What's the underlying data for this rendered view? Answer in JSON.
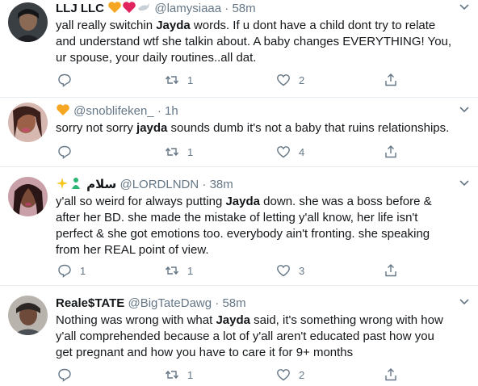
{
  "tweets": [
    {
      "name": "LLJ LLC",
      "handle": "@lamysiaaa",
      "dot": "·",
      "time": "58m",
      "lines": [
        [
          "yall really switchin ",
          "Jayda",
          " words. If u dont have a child dont try to relate"
        ],
        [
          "and understand wtf she talkin about. A baby changes EVERYTHING! You,",
          "",
          ""
        ],
        [
          "ur spouse, your daily routines..all dat.",
          "",
          ""
        ]
      ],
      "reply_count": "",
      "retweet_count": "1",
      "like_count": "2"
    },
    {
      "name": "",
      "handle": "@snoblifeken_",
      "dot": "·",
      "time": "1h",
      "lines": [
        [
          "sorry not sorry ",
          "jayda",
          " sounds dumb it's not a baby that ruins relationships."
        ]
      ],
      "reply_count": "",
      "retweet_count": "1",
      "like_count": "4"
    },
    {
      "name": "سلام",
      "handle": "@LORDLNDN",
      "dot": "·",
      "time": "38m",
      "lines": [
        [
          "y'all so weird for always putting ",
          "Jayda",
          " down. she was a boss before &"
        ],
        [
          "after her BD. she made the mistake of letting y'all know, her life isn't",
          "",
          ""
        ],
        [
          "perfect & she got emotions too. everybody ain't fronting. she speaking",
          "",
          ""
        ],
        [
          "from her REAL point of view.",
          "",
          ""
        ]
      ],
      "reply_count": "1",
      "retweet_count": "1",
      "like_count": "3"
    },
    {
      "name": "Reale$TATE",
      "handle": "@BigTateDawg",
      "dot": "·",
      "time": "58m",
      "lines": [
        [
          "Nothing was wrong with what ",
          "Jayda",
          " said, it's something wrong with how"
        ],
        [
          "y'all comprehended because a lot of y'all aren't educated past how you",
          "",
          ""
        ],
        [
          "get pregnant and how you have to care it for 9+ months",
          "",
          ""
        ]
      ],
      "reply_count": "",
      "retweet_count": "1",
      "like_count": "2"
    }
  ],
  "colors": {
    "text": "#14171a",
    "muted": "#657786",
    "border": "#e6ecf0",
    "heart": "#e0245e",
    "orange_heart": "#f5a623"
  },
  "icons": [
    "reply-icon",
    "retweet-icon",
    "like-icon",
    "share-icon",
    "caret-down-icon"
  ]
}
